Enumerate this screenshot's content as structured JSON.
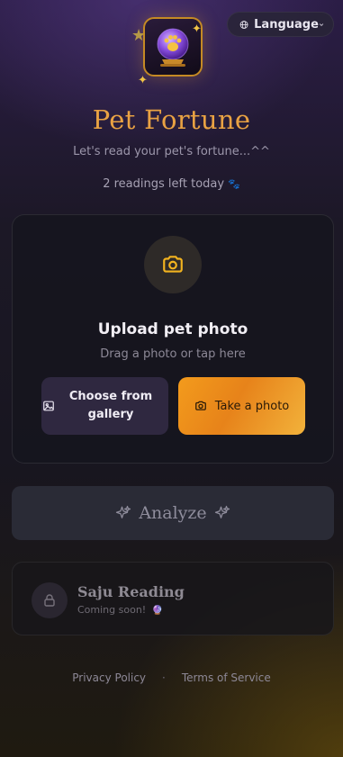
{
  "header": {
    "language_label": "Language",
    "globe_icon": "globe-icon",
    "chevron_icon": "chevron-down-icon"
  },
  "hero": {
    "logo_icon": "crystal-ball-paw-icon",
    "title": "Pet Fortune",
    "subtitle": "Let's read your pet's fortune...^^",
    "readings_left": "2 readings left today",
    "paw_icon": "paw-icon"
  },
  "upload": {
    "camera_icon": "camera-icon",
    "title": "Upload pet photo",
    "subtitle": "Drag a photo or tap here",
    "gallery_button": "Choose from gallery",
    "photo_button": "Take a photo"
  },
  "analyze": {
    "label": "Analyze"
  },
  "saju": {
    "title": "Saju Reading",
    "subtitle": "Coming soon!",
    "lock_icon": "lock-icon"
  },
  "footer": {
    "privacy": "Privacy Policy",
    "separator": "·",
    "terms": "Terms of Service"
  },
  "colors": {
    "accent": "#e9a243",
    "primary_button": "#f39b1c",
    "background": "#1c1826"
  }
}
